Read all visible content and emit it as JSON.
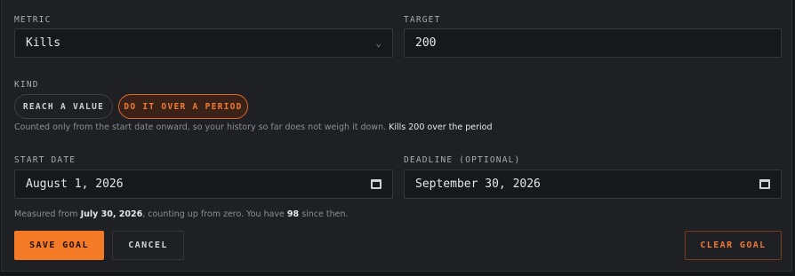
{
  "metric": {
    "label": "METRIC",
    "value": "Kills",
    "icon": "chevron-down-icon"
  },
  "target": {
    "label": "TARGET",
    "value": "200"
  },
  "kind": {
    "label": "KIND",
    "options": [
      {
        "label": "REACH A VALUE",
        "selected": false
      },
      {
        "label": "DO IT OVER A PERIOD",
        "selected": true
      }
    ],
    "hint": "Counted only from the start date onward, so your history so far does not weigh it down.",
    "hint_highlight": "Kills 200 over the period"
  },
  "start_date": {
    "label": "START DATE",
    "value": "August 1, 2026",
    "icon": "calendar-icon"
  },
  "deadline": {
    "label": "DEADLINE (OPTIONAL)",
    "value": "September 30, 2026",
    "icon": "calendar-icon"
  },
  "measured": {
    "prefix": "Measured from",
    "date": "July 30, 2026",
    "middle": ", counting up from zero. You have",
    "count": "98",
    "suffix": "since then."
  },
  "actions": {
    "save": "SAVE GOAL",
    "cancel": "CANCEL",
    "clear": "CLEAR GOAL"
  },
  "colors": {
    "accent": "#f57a25",
    "panel": "#1e2024",
    "field": "#17181b"
  }
}
